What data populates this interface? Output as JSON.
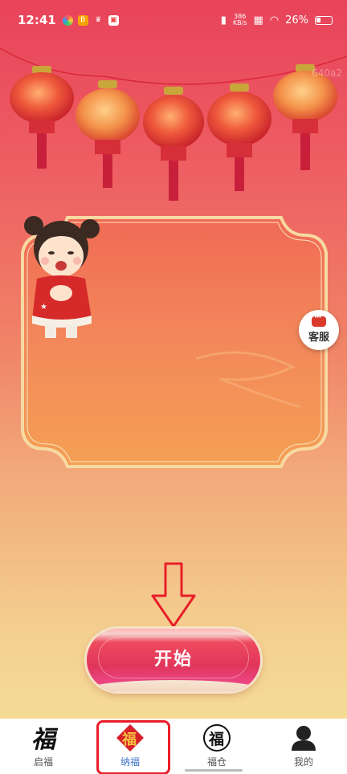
{
  "status_bar": {
    "time": "12:41",
    "net_speed_value": "386",
    "net_speed_unit": "KB/s",
    "battery": "26%"
  },
  "watermark": "640a2",
  "kefu": {
    "label": "客服",
    "icon": "chat-bubble-icon"
  },
  "start_button": {
    "label": "开始"
  },
  "bottom_nav": {
    "items": [
      {
        "label": "启福",
        "icon": "fu-calligraphy-icon",
        "active": false
      },
      {
        "label": "纳福",
        "icon": "fu-diamond-icon",
        "active": true
      },
      {
        "label": "福仓",
        "icon": "fu-circle-icon",
        "active": false
      },
      {
        "label": "我的",
        "icon": "user-icon",
        "active": false
      }
    ]
  },
  "colors": {
    "accent_red": "#e81e2a",
    "active_tab": "#3a70c8",
    "button_pink": "#e0355a"
  }
}
